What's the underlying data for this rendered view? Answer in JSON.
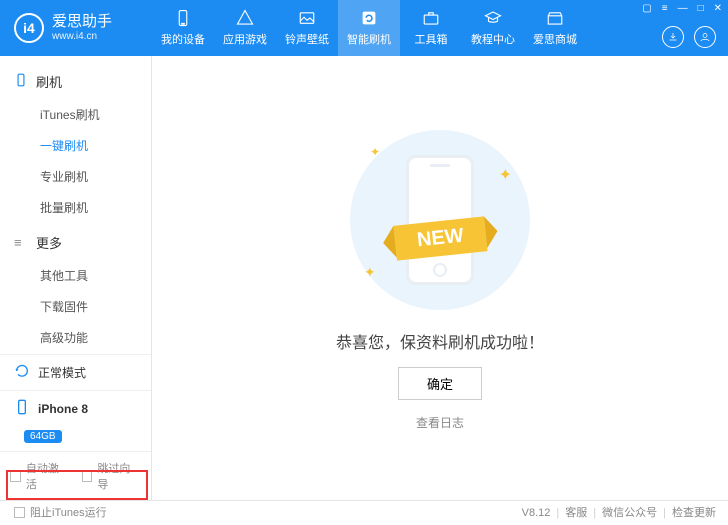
{
  "brand": {
    "title": "爱思助手",
    "url": "www.i4.cn",
    "logo": "i4"
  },
  "nav": {
    "items": [
      {
        "label": "我的设备",
        "name": "nav-mydevice"
      },
      {
        "label": "应用游戏",
        "name": "nav-apps"
      },
      {
        "label": "铃声壁纸",
        "name": "nav-ringtones"
      },
      {
        "label": "智能刷机",
        "name": "nav-flash",
        "active": true
      },
      {
        "label": "工具箱",
        "name": "nav-toolbox"
      },
      {
        "label": "教程中心",
        "name": "nav-tutorials"
      },
      {
        "label": "爱思商城",
        "name": "nav-store"
      }
    ]
  },
  "sidebar": {
    "sections": [
      {
        "head": "刷机",
        "items": [
          {
            "label": "iTunes刷机"
          },
          {
            "label": "一键刷机",
            "active": true
          },
          {
            "label": "专业刷机"
          },
          {
            "label": "批量刷机"
          }
        ]
      },
      {
        "head": "更多",
        "items": [
          {
            "label": "其他工具"
          },
          {
            "label": "下载固件"
          },
          {
            "label": "高级功能"
          }
        ]
      }
    ],
    "mode": "正常模式",
    "device": "iPhone 8",
    "storage": "64GB",
    "options": {
      "autoActivate": "自动激活",
      "skipWizard": "跳过向导"
    }
  },
  "main": {
    "ribbon": "NEW",
    "success": "恭喜您，保资料刷机成功啦！",
    "ok": "确定",
    "viewLog": "查看日志"
  },
  "footer": {
    "blockItunes": "阻止iTunes运行",
    "version": "V8.12",
    "support": "客服",
    "wechat": "微信公众号",
    "checkUpdate": "检查更新"
  }
}
